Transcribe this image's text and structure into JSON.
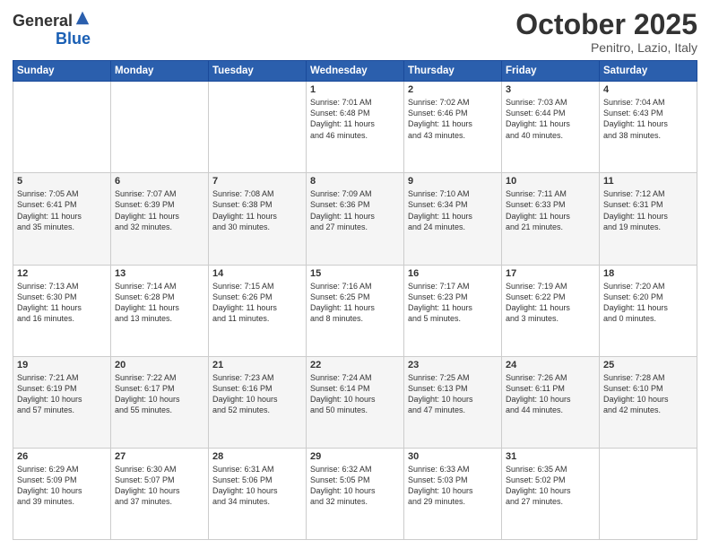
{
  "header": {
    "logo_line1": "General",
    "logo_line2": "Blue",
    "month": "October 2025",
    "location": "Penitro, Lazio, Italy"
  },
  "weekdays": [
    "Sunday",
    "Monday",
    "Tuesday",
    "Wednesday",
    "Thursday",
    "Friday",
    "Saturday"
  ],
  "weeks": [
    [
      {
        "day": "",
        "text": ""
      },
      {
        "day": "",
        "text": ""
      },
      {
        "day": "",
        "text": ""
      },
      {
        "day": "1",
        "text": "Sunrise: 7:01 AM\nSunset: 6:48 PM\nDaylight: 11 hours\nand 46 minutes."
      },
      {
        "day": "2",
        "text": "Sunrise: 7:02 AM\nSunset: 6:46 PM\nDaylight: 11 hours\nand 43 minutes."
      },
      {
        "day": "3",
        "text": "Sunrise: 7:03 AM\nSunset: 6:44 PM\nDaylight: 11 hours\nand 40 minutes."
      },
      {
        "day": "4",
        "text": "Sunrise: 7:04 AM\nSunset: 6:43 PM\nDaylight: 11 hours\nand 38 minutes."
      }
    ],
    [
      {
        "day": "5",
        "text": "Sunrise: 7:05 AM\nSunset: 6:41 PM\nDaylight: 11 hours\nand 35 minutes."
      },
      {
        "day": "6",
        "text": "Sunrise: 7:07 AM\nSunset: 6:39 PM\nDaylight: 11 hours\nand 32 minutes."
      },
      {
        "day": "7",
        "text": "Sunrise: 7:08 AM\nSunset: 6:38 PM\nDaylight: 11 hours\nand 30 minutes."
      },
      {
        "day": "8",
        "text": "Sunrise: 7:09 AM\nSunset: 6:36 PM\nDaylight: 11 hours\nand 27 minutes."
      },
      {
        "day": "9",
        "text": "Sunrise: 7:10 AM\nSunset: 6:34 PM\nDaylight: 11 hours\nand 24 minutes."
      },
      {
        "day": "10",
        "text": "Sunrise: 7:11 AM\nSunset: 6:33 PM\nDaylight: 11 hours\nand 21 minutes."
      },
      {
        "day": "11",
        "text": "Sunrise: 7:12 AM\nSunset: 6:31 PM\nDaylight: 11 hours\nand 19 minutes."
      }
    ],
    [
      {
        "day": "12",
        "text": "Sunrise: 7:13 AM\nSunset: 6:30 PM\nDaylight: 11 hours\nand 16 minutes."
      },
      {
        "day": "13",
        "text": "Sunrise: 7:14 AM\nSunset: 6:28 PM\nDaylight: 11 hours\nand 13 minutes."
      },
      {
        "day": "14",
        "text": "Sunrise: 7:15 AM\nSunset: 6:26 PM\nDaylight: 11 hours\nand 11 minutes."
      },
      {
        "day": "15",
        "text": "Sunrise: 7:16 AM\nSunset: 6:25 PM\nDaylight: 11 hours\nand 8 minutes."
      },
      {
        "day": "16",
        "text": "Sunrise: 7:17 AM\nSunset: 6:23 PM\nDaylight: 11 hours\nand 5 minutes."
      },
      {
        "day": "17",
        "text": "Sunrise: 7:19 AM\nSunset: 6:22 PM\nDaylight: 11 hours\nand 3 minutes."
      },
      {
        "day": "18",
        "text": "Sunrise: 7:20 AM\nSunset: 6:20 PM\nDaylight: 11 hours\nand 0 minutes."
      }
    ],
    [
      {
        "day": "19",
        "text": "Sunrise: 7:21 AM\nSunset: 6:19 PM\nDaylight: 10 hours\nand 57 minutes."
      },
      {
        "day": "20",
        "text": "Sunrise: 7:22 AM\nSunset: 6:17 PM\nDaylight: 10 hours\nand 55 minutes."
      },
      {
        "day": "21",
        "text": "Sunrise: 7:23 AM\nSunset: 6:16 PM\nDaylight: 10 hours\nand 52 minutes."
      },
      {
        "day": "22",
        "text": "Sunrise: 7:24 AM\nSunset: 6:14 PM\nDaylight: 10 hours\nand 50 minutes."
      },
      {
        "day": "23",
        "text": "Sunrise: 7:25 AM\nSunset: 6:13 PM\nDaylight: 10 hours\nand 47 minutes."
      },
      {
        "day": "24",
        "text": "Sunrise: 7:26 AM\nSunset: 6:11 PM\nDaylight: 10 hours\nand 44 minutes."
      },
      {
        "day": "25",
        "text": "Sunrise: 7:28 AM\nSunset: 6:10 PM\nDaylight: 10 hours\nand 42 minutes."
      }
    ],
    [
      {
        "day": "26",
        "text": "Sunrise: 6:29 AM\nSunset: 5:09 PM\nDaylight: 10 hours\nand 39 minutes."
      },
      {
        "day": "27",
        "text": "Sunrise: 6:30 AM\nSunset: 5:07 PM\nDaylight: 10 hours\nand 37 minutes."
      },
      {
        "day": "28",
        "text": "Sunrise: 6:31 AM\nSunset: 5:06 PM\nDaylight: 10 hours\nand 34 minutes."
      },
      {
        "day": "29",
        "text": "Sunrise: 6:32 AM\nSunset: 5:05 PM\nDaylight: 10 hours\nand 32 minutes."
      },
      {
        "day": "30",
        "text": "Sunrise: 6:33 AM\nSunset: 5:03 PM\nDaylight: 10 hours\nand 29 minutes."
      },
      {
        "day": "31",
        "text": "Sunrise: 6:35 AM\nSunset: 5:02 PM\nDaylight: 10 hours\nand 27 minutes."
      },
      {
        "day": "",
        "text": ""
      }
    ]
  ]
}
